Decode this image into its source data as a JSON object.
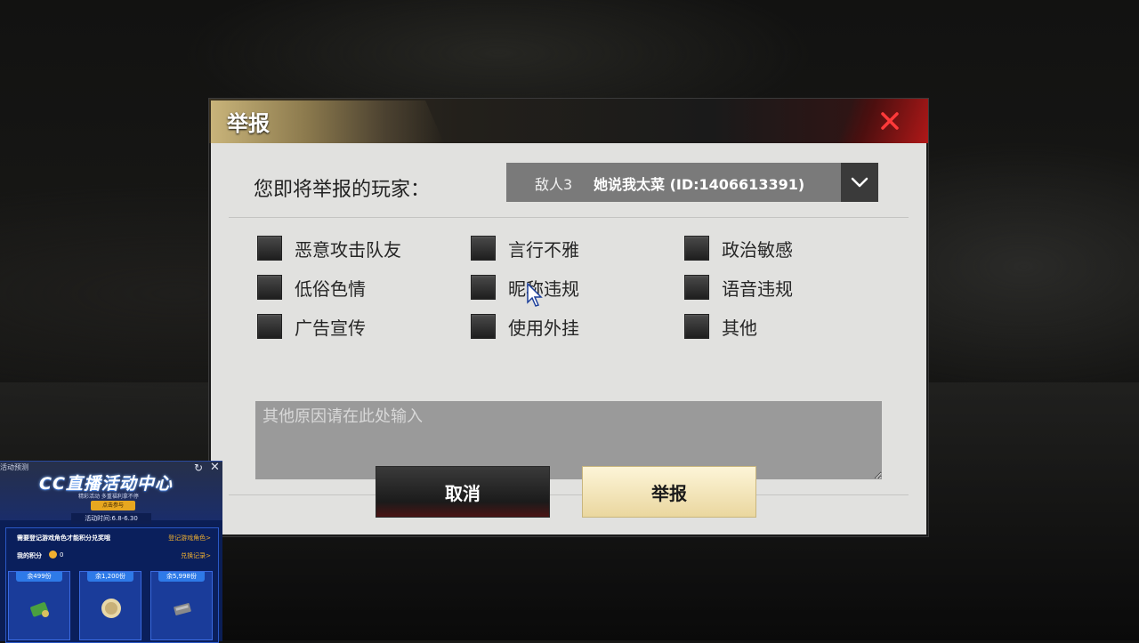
{
  "dialog": {
    "title": "举报",
    "player_label": "您即将举报的玩家：",
    "player_team": "敌人3",
    "player_name": "她说我太菜 (ID:1406613391)",
    "reasons": [
      {
        "label": "恶意攻击队友",
        "checked": false
      },
      {
        "label": "言行不雅",
        "checked": false
      },
      {
        "label": "政治敏感",
        "checked": false
      },
      {
        "label": "低俗色情",
        "checked": false
      },
      {
        "label": "昵称违规",
        "checked": false
      },
      {
        "label": "语音违规",
        "checked": false
      },
      {
        "label": "广告宣传",
        "checked": false
      },
      {
        "label": "使用外挂",
        "checked": false
      },
      {
        "label": "其他",
        "checked": false
      }
    ],
    "other_placeholder": "其他原因请在此处输入",
    "cancel_label": "取消",
    "report_label": "举报"
  },
  "live_panel": {
    "tag": "活动预测",
    "title": "CC直播活动中心",
    "subtitle": "精彩活动  多重福利拿不停",
    "button": "点击参与",
    "date": "活动时间:6.8-6.30",
    "requirement": "需要登记游戏角色才能积分兑奖哦",
    "register_link": "登记游戏角色>",
    "points_label": "我的积分",
    "points_value": "0",
    "history_link": "兑换记录>",
    "rewards": [
      {
        "count": "余499份",
        "icon": "keycard-icon"
      },
      {
        "count": "余1,200份",
        "icon": "coin-bundle-icon"
      },
      {
        "count": "余5,998份",
        "icon": "ammo-box-icon"
      }
    ]
  },
  "colors": {
    "dialog_body": "#e1e1df",
    "accent_gold": "#c9b47a",
    "close_red": "#b01818",
    "panel_blue": "#0b1e55"
  }
}
